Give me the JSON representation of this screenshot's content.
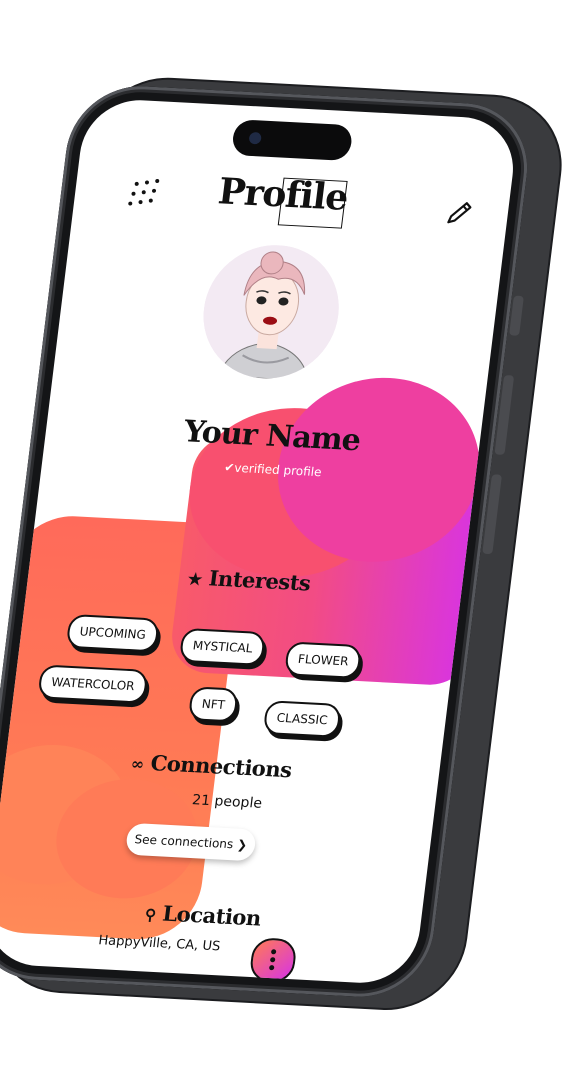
{
  "header": {
    "title": "Profile",
    "menu_icon": "grid-dots-icon",
    "edit_icon": "pencil-icon"
  },
  "profile": {
    "name": "Your Name",
    "verified_mark": "✔",
    "verified_text": "verified profile"
  },
  "interests": {
    "title_icon": "★",
    "title": "Interests",
    "chips": [
      "UPCOMING",
      "MYSTICAL",
      "FLOWER",
      "WATERCOLOR",
      "NFT",
      "CLASSIC"
    ]
  },
  "connections": {
    "title_icon": "∞",
    "title": "Connections",
    "count": "21 people",
    "button_label": "See connections",
    "button_arrow": "❯"
  },
  "location": {
    "title_icon": "⚲",
    "title": "Location",
    "value": "HappyVille, CA, US"
  },
  "colors": {
    "accent_orange": "#ff7a55",
    "accent_pink": "#f24c84",
    "accent_purple": "#d733e6",
    "text": "#111111"
  }
}
